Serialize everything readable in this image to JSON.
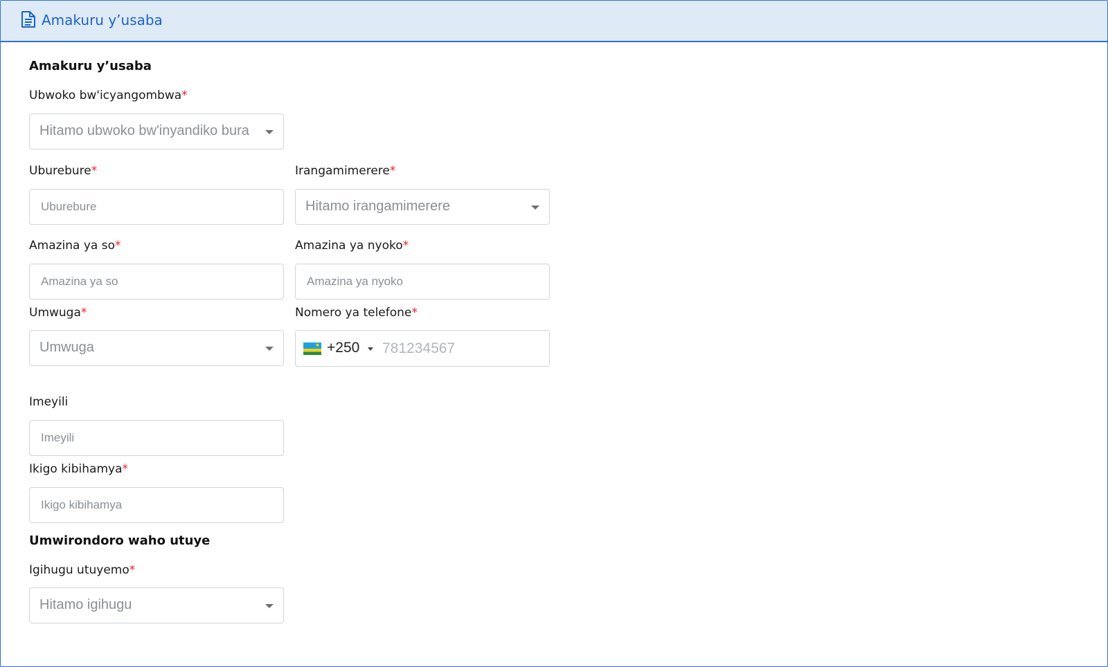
{
  "header": {
    "title": "Amakuru y’usaba",
    "icon": "document-icon"
  },
  "applicant_section": {
    "title": "Amakuru y’usaba",
    "document_type": {
      "label": "Ubwoko bw'icyangombwa",
      "required_mark": "*",
      "placeholder": "Hitamo ubwoko bw'inyandiko bura"
    },
    "surname": {
      "label": "Uburebure",
      "required_mark": "*",
      "placeholder": "Uburebure"
    },
    "gender": {
      "label": "Irangamimerere",
      "required_mark": "*",
      "placeholder": "Hitamo irangamimerere"
    },
    "father_name": {
      "label": "Amazina ya so",
      "required_mark": "*",
      "placeholder": "Amazina ya so"
    },
    "mother_name": {
      "label": "Amazina ya nyoko",
      "required_mark": "*",
      "placeholder": "Amazina ya nyoko"
    },
    "occupation": {
      "label": "Umwuga",
      "required_mark": "*",
      "placeholder": "Umwuga"
    },
    "phone": {
      "label": "Nomero ya telefone",
      "required_mark": "*",
      "dial_code": "+250",
      "flag": "rwanda-flag-icon",
      "placeholder": "781234567"
    },
    "email": {
      "label": "Imeyili",
      "placeholder": "Imeyili"
    },
    "institution": {
      "label": "Ikigo kibihamya",
      "required_mark": "*",
      "placeholder": "Ikigo kibihamya"
    }
  },
  "address_section": {
    "title": "Umwirondoro waho utuye",
    "country": {
      "label": "Igihugu utuyemo",
      "required_mark": "*",
      "placeholder": "Hitamo igihugu"
    }
  },
  "colors": {
    "accent": "#1a63c6",
    "header_bg": "#dfeaf7",
    "border": "#2f6fd0",
    "required": "#e8202a"
  }
}
